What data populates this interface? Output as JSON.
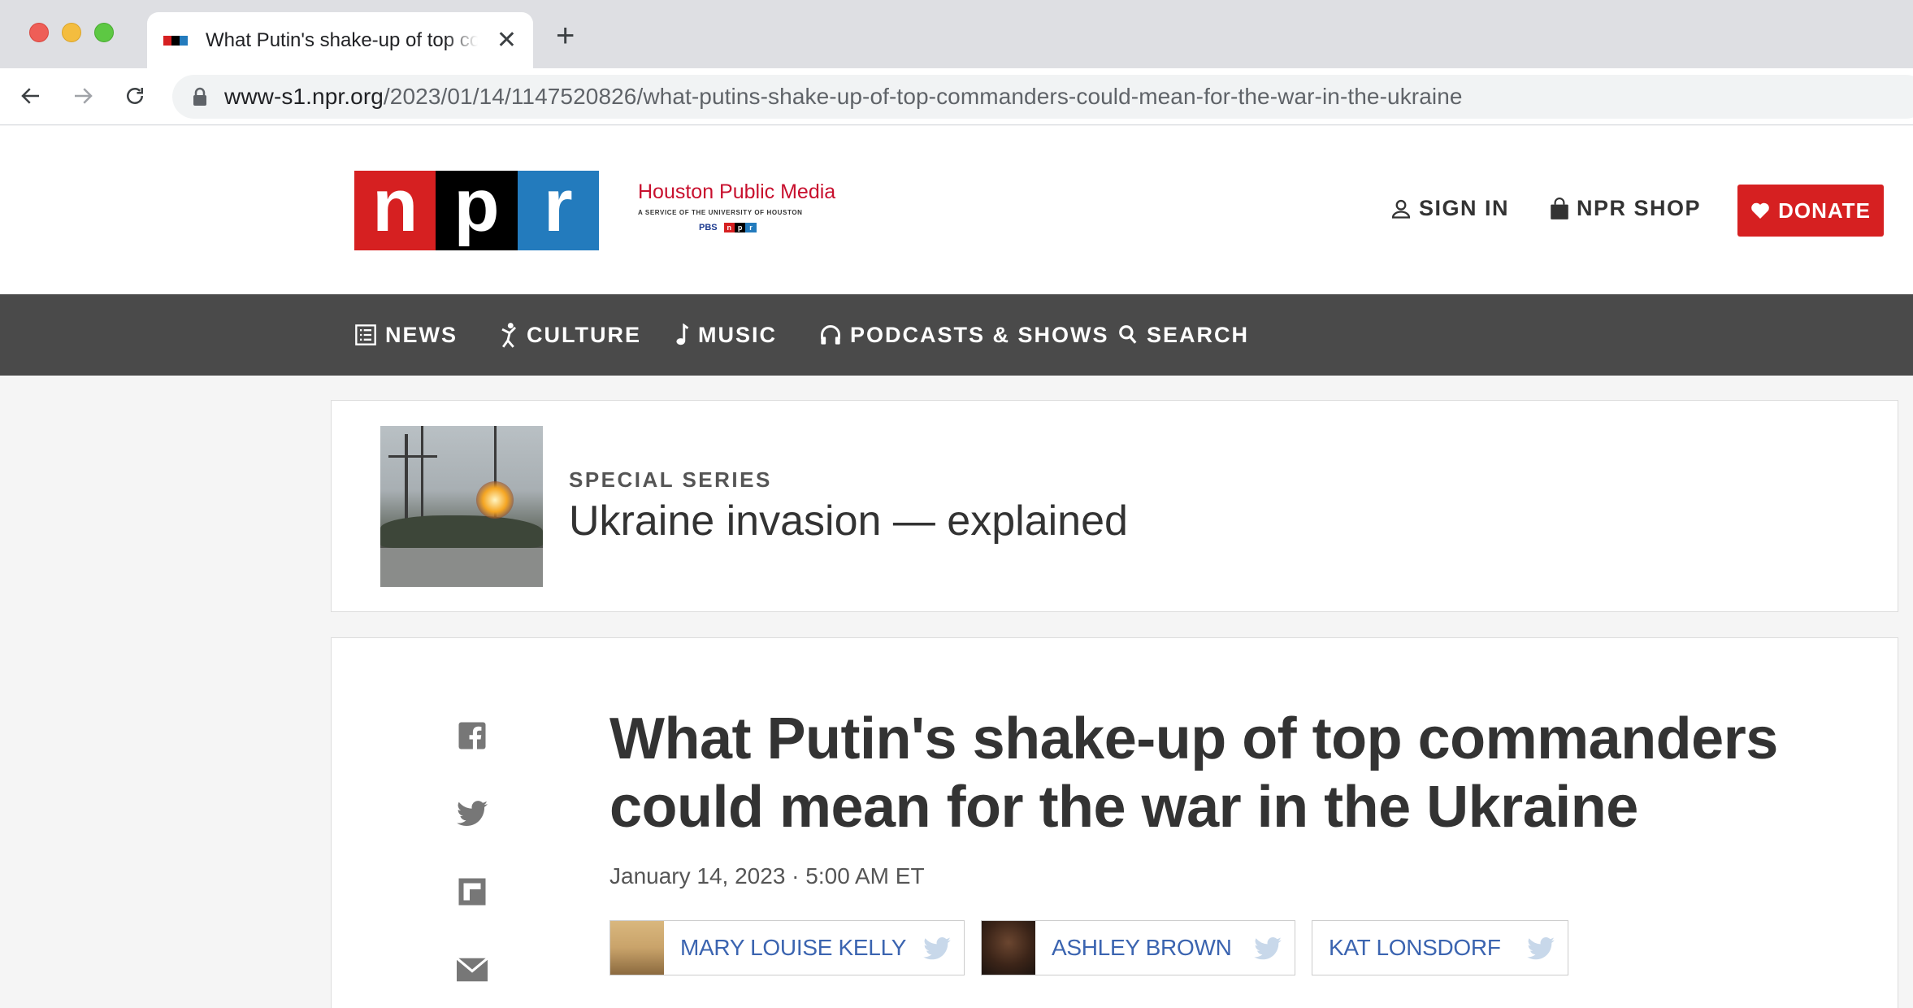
{
  "browser": {
    "tab_title": "What Putin's shake-up of top commanders could mean for the war in the Ukraine",
    "tab_close": "✕",
    "new_tab": "+",
    "url_host": "www-s1.npr.org",
    "url_path": "/2023/01/14/1147520826/what-putins-shake-up-of-top-commanders-could-mean-for-the-war-in-the-ukraine"
  },
  "header": {
    "logo_letters": [
      "n",
      "p",
      "r"
    ],
    "station_name": "Houston Public Media",
    "station_sub": "A SERVICE OF THE UNIVERSITY OF HOUSTON",
    "station_pbs": "PBS",
    "sign_in": "SIGN IN",
    "shop": "NPR SHOP",
    "donate": "DONATE"
  },
  "nav": {
    "items": [
      {
        "label": "NEWS",
        "icon": "news-icon"
      },
      {
        "label": "CULTURE",
        "icon": "culture-icon"
      },
      {
        "label": "MUSIC",
        "icon": "music-note-icon"
      },
      {
        "label": "PODCASTS & SHOWS",
        "icon": "headphones-icon"
      },
      {
        "label": "SEARCH",
        "icon": "search-icon"
      }
    ]
  },
  "series": {
    "eyebrow": "SPECIAL SERIES",
    "title": "Ukraine invasion — explained"
  },
  "story": {
    "headline": "What Putin's shake-up of top commanders could mean for the war in the Ukraine",
    "date": "January 14, 2023 · 5:00 AM ET",
    "share_icons": [
      "facebook-icon",
      "twitter-icon",
      "flipboard-icon",
      "email-icon"
    ],
    "bylines": [
      {
        "name": "MARY LOUISE KELLY"
      },
      {
        "name": "ASHLEY BROWN"
      },
      {
        "name": "KAT LONSDORF"
      }
    ]
  },
  "colors": {
    "npr_red": "#d62021",
    "npr_blue": "#237bbd",
    "nav_bg": "#4a4a4a",
    "byline_link": "#3b64b0"
  }
}
